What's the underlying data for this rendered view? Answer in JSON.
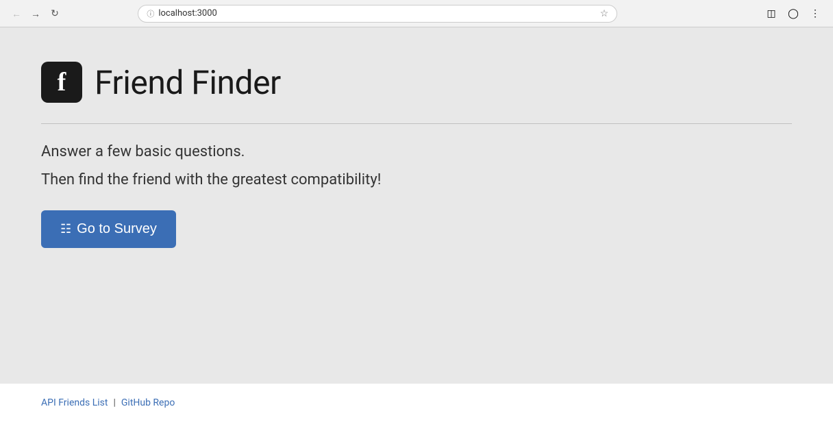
{
  "browser": {
    "url": "localhost:3000",
    "back_disabled": false,
    "forward_disabled": false
  },
  "header": {
    "icon_letter": "f",
    "title": "Friend Finder"
  },
  "main": {
    "subtitle_1": "Answer a few basic questions.",
    "subtitle_2": "Then find the friend with the greatest compatibility!",
    "cta_button": "Go to Survey",
    "cta_icon": "list-icon"
  },
  "footer": {
    "link1_label": "API Friends List",
    "link2_label": "GitHub Repo",
    "separator": "|"
  }
}
